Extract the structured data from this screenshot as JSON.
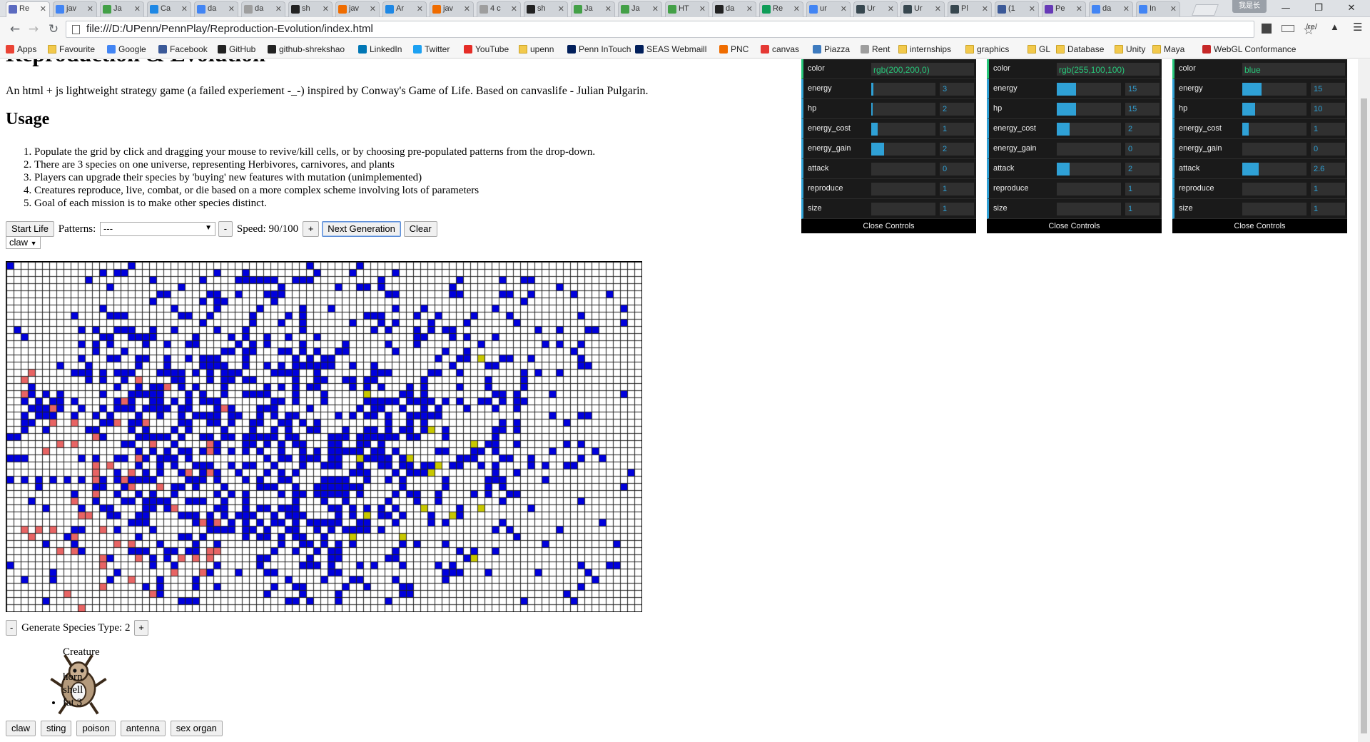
{
  "browser": {
    "tabs": [
      {
        "label": "Re",
        "color": "#5c6bc0"
      },
      {
        "label": "jav",
        "color": "#4285f4"
      },
      {
        "label": "Ja",
        "color": "#43a047"
      },
      {
        "label": "Ca",
        "color": "#1e88e5"
      },
      {
        "label": "da",
        "color": "#4285f4"
      },
      {
        "label": "da",
        "color": "#9e9e9e"
      },
      {
        "label": "sh",
        "color": "#222222"
      },
      {
        "label": "jav",
        "color": "#ef6c00"
      },
      {
        "label": "Ar",
        "color": "#1e88e5"
      },
      {
        "label": "jav",
        "color": "#ef6c00"
      },
      {
        "label": "4 c",
        "color": "#9e9e9e"
      },
      {
        "label": "sh",
        "color": "#222222"
      },
      {
        "label": "Ja",
        "color": "#43a047"
      },
      {
        "label": "Ja",
        "color": "#43a047"
      },
      {
        "label": "HT",
        "color": "#43a047"
      },
      {
        "label": "da",
        "color": "#222222"
      },
      {
        "label": "Re",
        "color": "#0f9d58"
      },
      {
        "label": "ur",
        "color": "#4285f4"
      },
      {
        "label": "Ur",
        "color": "#37474f"
      },
      {
        "label": "Ur",
        "color": "#37474f"
      },
      {
        "label": "Pl",
        "color": "#37474f"
      },
      {
        "label": "(1",
        "color": "#3b5998"
      },
      {
        "label": "Pe",
        "color": "#673ab7"
      },
      {
        "label": "da",
        "color": "#4285f4"
      },
      {
        "label": "In",
        "color": "#4285f4"
      }
    ],
    "profile_label": "我是长",
    "url": "file:///D:/UPenn/PennPlay/Reproduction-Evolution/index.html",
    "ext_label": "/re/",
    "bookmarks": [
      {
        "label": "Apps",
        "icon": "apps-icon",
        "color": "#ea4335"
      },
      {
        "label": "Favourite",
        "icon": "folder-icon",
        "color": "#f2c94c"
      },
      {
        "label": "Google",
        "icon": "google-icon",
        "color": "#4285f4"
      },
      {
        "label": "Facebook",
        "icon": "facebook-icon",
        "color": "#3b5998"
      },
      {
        "label": "GitHub",
        "icon": "github-icon",
        "color": "#222222"
      },
      {
        "label": "github-shrekshao",
        "icon": "github-icon",
        "color": "#222222"
      },
      {
        "label": "LinkedIn",
        "icon": "linkedin-icon",
        "color": "#0077b5"
      },
      {
        "label": "Twitter",
        "icon": "twitter-icon",
        "color": "#1da1f2"
      },
      {
        "label": "YouTube",
        "icon": "youtube-icon",
        "color": "#e52d27"
      },
      {
        "label": "upenn",
        "icon": "folder-icon",
        "color": "#f2c94c"
      },
      {
        "label": "Penn InTouch",
        "icon": "shield-icon",
        "color": "#011f5b"
      },
      {
        "label": "SEAS Webmaill",
        "icon": "seas-icon",
        "color": "#011f5b"
      },
      {
        "label": "PNC",
        "icon": "pnc-icon",
        "color": "#ef6c00"
      },
      {
        "label": "canvas",
        "icon": "canvas-icon",
        "color": "#e53935"
      },
      {
        "label": "Piazza",
        "icon": "piazza-icon",
        "color": "#3e7bbf"
      },
      {
        "label": "Rent",
        "icon": "page-icon",
        "color": "#9e9e9e"
      },
      {
        "label": "internships",
        "icon": "folder-icon",
        "color": "#f2c94c"
      },
      {
        "label": "graphics",
        "icon": "folder-icon",
        "color": "#f2c94c"
      },
      {
        "label": "GL",
        "icon": "folder-icon",
        "color": "#f2c94c"
      },
      {
        "label": "Database",
        "icon": "folder-icon",
        "color": "#f2c94c"
      },
      {
        "label": "Unity",
        "icon": "folder-icon",
        "color": "#f2c94c"
      },
      {
        "label": "Maya",
        "icon": "folder-icon",
        "color": "#f2c94c"
      },
      {
        "label": "WebGL Conformance",
        "icon": "webgl-icon",
        "color": "#c62828"
      }
    ]
  },
  "page": {
    "title": "Reproduction & Evolution",
    "intro": "An html + js lightweight strategy game (a failed experiement -_-) inspired by Conway's Game of Life. Based on canvaslife - Julian Pulgarin.",
    "usage_heading": "Usage",
    "usage_items": [
      "Populate the grid by click and dragging your mouse to revive/kill cells, or by choosing pre-populated patterns from the drop-down.",
      "There are 3 species on one universe, representing Herbivores, carnivores, and plants",
      "Players can upgrade their species by 'buying' new features with mutation (unimplemented)",
      "Creatures reproduce, live, combat, or die based on a more complex scheme involving lots of parameters",
      "Goal of each mission is to make other species distinct."
    ],
    "controls": {
      "start_label": "Start Life",
      "patterns_label": "Patterns:",
      "patterns_value": "---",
      "minus_label": "-",
      "speed_label": "Speed: 90/100",
      "plus_label": "+",
      "next_label": "Next Generation",
      "clear_label": "Clear",
      "feature_select_value": "claw"
    },
    "species": {
      "minus_label": "-",
      "label": "Generate Species Type: 2",
      "plus_label": "+"
    },
    "creature": {
      "title": "Creature",
      "parts": [
        "horn",
        "shell"
      ],
      "bullet_parts": [
        "fat 3"
      ]
    },
    "part_buttons": [
      "claw",
      "sting",
      "poison",
      "antenna",
      "sex organ"
    ]
  },
  "grid_colors": {
    "herbivore": "#0000dd",
    "carnivore": "#e86464",
    "plant": "#c8c800",
    "line": "#222222"
  },
  "gui_panels": [
    {
      "color": "rgb(200,200,0)",
      "params": [
        {
          "name": "energy",
          "value": "3",
          "level": 0.03
        },
        {
          "name": "hp",
          "value": "2",
          "level": 0.02
        },
        {
          "name": "energy_cost",
          "value": "1",
          "level": 0.1
        },
        {
          "name": "energy_gain",
          "value": "2",
          "level": 0.2
        },
        {
          "name": "attack",
          "value": "0",
          "level": 0
        },
        {
          "name": "reproduce",
          "value": "1",
          "level": 0
        },
        {
          "name": "size",
          "value": "1",
          "level": 0
        }
      ],
      "close_label": "Close Controls"
    },
    {
      "color": "rgb(255,100,100)",
      "params": [
        {
          "name": "energy",
          "value": "15",
          "level": 0.3
        },
        {
          "name": "hp",
          "value": "15",
          "level": 0.3
        },
        {
          "name": "energy_cost",
          "value": "2",
          "level": 0.2
        },
        {
          "name": "energy_gain",
          "value": "0",
          "level": 0
        },
        {
          "name": "attack",
          "value": "2",
          "level": 0.2
        },
        {
          "name": "reproduce",
          "value": "1",
          "level": 0
        },
        {
          "name": "size",
          "value": "1",
          "level": 0
        }
      ],
      "close_label": "Close Controls"
    },
    {
      "color": "blue",
      "params": [
        {
          "name": "energy",
          "value": "15",
          "level": 0.3
        },
        {
          "name": "hp",
          "value": "10",
          "level": 0.2
        },
        {
          "name": "energy_cost",
          "value": "1",
          "level": 0.1
        },
        {
          "name": "energy_gain",
          "value": "0",
          "level": 0
        },
        {
          "name": "attack",
          "value": "2.6",
          "level": 0.26
        },
        {
          "name": "reproduce",
          "value": "1",
          "level": 0
        },
        {
          "name": "size",
          "value": "1",
          "level": 0
        }
      ],
      "close_label": "Close Controls"
    }
  ]
}
